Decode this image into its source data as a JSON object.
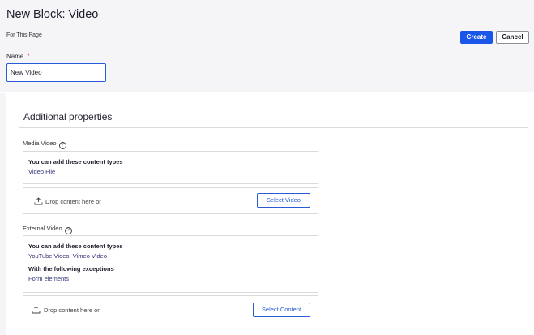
{
  "header": {
    "title": "New Block: Video",
    "subtitle": "For This Page",
    "create_label": "Create",
    "cancel_label": "Cancel"
  },
  "name_field": {
    "label": "Name",
    "required_mark": "*",
    "value": "New Video"
  },
  "section": {
    "title": "Additional properties"
  },
  "media_video": {
    "label": "Media Video",
    "help_glyph": "?",
    "types_heading": "You can add these content types",
    "types_value": "Video File",
    "drop_text": "Drop content here or",
    "select_label": "Select Video"
  },
  "external_video": {
    "label": "External Video",
    "help_glyph": "?",
    "types_heading": "You can add these content types",
    "types_value": "YouTube Video, Vimeo Video",
    "exceptions_heading": "With the following exceptions",
    "exceptions_value": "Form elements",
    "drop_text": "Drop content here or",
    "select_label": "Select Content"
  },
  "icons": {
    "help": "help-circle-icon",
    "upload": "upload-tray-icon"
  },
  "colors": {
    "primary": "#1a56e8",
    "required": "#d0312d",
    "border": "#d9d9de",
    "header_bg": "#f5f5f7"
  }
}
